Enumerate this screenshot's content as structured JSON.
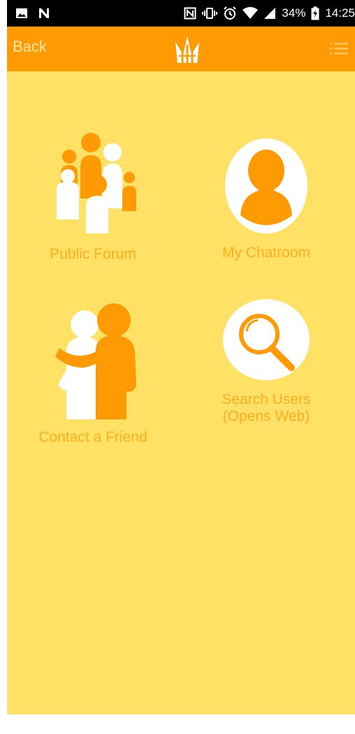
{
  "status_bar": {
    "battery_percent": "34%",
    "time": "14:25",
    "left_icons": [
      "image-icon",
      "n-app-icon"
    ],
    "right_icons": [
      "nfc-icon",
      "vibrate-icon",
      "alarm-icon",
      "wifi-icon",
      "signal-icon",
      "battery-icon"
    ]
  },
  "app_bar": {
    "back_label": "Back",
    "logo_icon": "flame-logo-icon",
    "menu_icon": "menu-icon"
  },
  "tiles": [
    {
      "label": "Public Forum",
      "icon": "group-people-icon"
    },
    {
      "label": "My Chatroom",
      "icon": "person-avatar-icon"
    },
    {
      "label": "Contact a Friend",
      "icon": "friends-hug-icon"
    },
    {
      "label": "Search Users\n(Opens Web)",
      "icon": "magnifier-icon"
    }
  ],
  "colors": {
    "app_bar": "#ff9a02",
    "background": "#ffe166",
    "accent": "#ff9a02",
    "label": "#ffae1f"
  }
}
